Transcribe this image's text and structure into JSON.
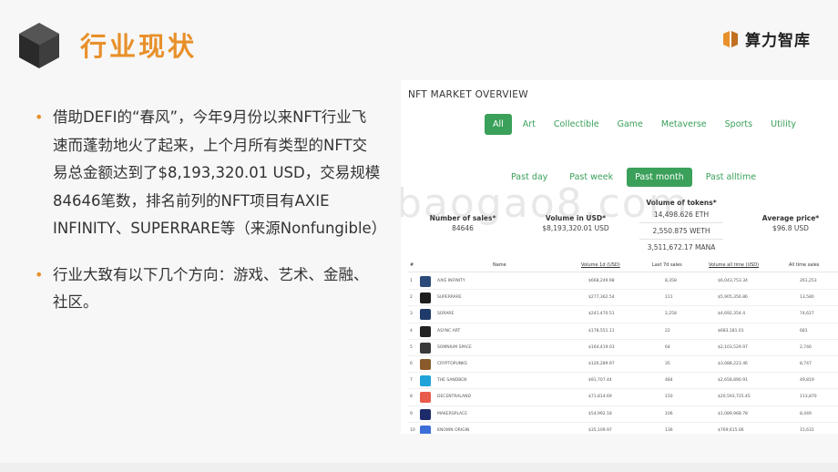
{
  "header": {
    "title": "行业现状",
    "brand": "算力智库"
  },
  "bullets": [
    "借助DEFI的“春风”，今年9月份以来NFT行业飞速而蓬勃地火了起来，上个月所有类型的NFT交易总金额达到了$8,193,320.01 USD，交易规模84646笔数，排名前列的NFT项目有AXIE INFINITY、SUPERRARE等（来源Nonfungible）",
    "行业大致有以下几个方向：游戏、艺术、金融、社区。"
  ],
  "panel": {
    "title": "NFT MARKET OVERVIEW",
    "categories": [
      "All",
      "Art",
      "Collectible",
      "Game",
      "Metaverse",
      "Sports",
      "Utility"
    ],
    "active_category": "All",
    "periods": [
      "Past day",
      "Past week",
      "Past month",
      "Past alltime"
    ],
    "active_period": "Past month",
    "stats": {
      "sales_label": "Number of sales*",
      "sales_value": "84646",
      "usd_label": "Volume in USD*",
      "usd_value": "$8,193,320.01 USD",
      "tokens_label": "Volume of tokens*",
      "tokens_values": [
        "14,498.626 ETH",
        "2,550.875 WETH",
        "3,511,672.17 MANA"
      ],
      "avg_label": "Average price*",
      "avg_value": "$96.8 USD"
    },
    "table": {
      "headers": [
        "#",
        "Name",
        "Volume 1d (USD)",
        "Last 7d sales",
        "Volume all time (USD)",
        "All time sales"
      ],
      "rows": [
        {
          "rank": "1",
          "name": "AXIE INFINITY",
          "vol": "$668,249.98",
          "sales7": "8,358",
          "alltime": "$6,043,753.34",
          "allsales": "261,253",
          "icon_color": "#2b4a7a"
        },
        {
          "rank": "2",
          "name": "SUPERRARE",
          "vol": "$277,362.54",
          "sales7": "111",
          "alltime": "$5,905,356.86",
          "allsales": "13,580",
          "icon_color": "#1d1d1d"
        },
        {
          "rank": "3",
          "name": "SORARE",
          "vol": "$241,470.51",
          "sales7": "2,258",
          "alltime": "$4,692,354.4",
          "allsales": "74,627",
          "icon_color": "#1f3b6b"
        },
        {
          "rank": "4",
          "name": "ASYNC ART",
          "vol": "$178,551.11",
          "sales7": "22",
          "alltime": "$683,181.01",
          "allsales": "681",
          "icon_color": "#222222"
        },
        {
          "rank": "5",
          "name": "SOMNIUM SPACE",
          "vol": "$164,419.03",
          "sales7": "64",
          "alltime": "$2,103,529.97",
          "allsales": "2,746",
          "icon_color": "#3a3a3a"
        },
        {
          "rank": "6",
          "name": "CRYPTOPUNKS",
          "vol": "$126,289.97",
          "sales7": "35",
          "alltime": "$3,088,223.46",
          "allsales": "8,747",
          "icon_color": "#8a5a2b"
        },
        {
          "rank": "7",
          "name": "THE SANDBOX",
          "vol": "$91,707.44",
          "sales7": "484",
          "alltime": "$2,658,890.91",
          "allsales": "49,819",
          "icon_color": "#1fa3d8"
        },
        {
          "rank": "8",
          "name": "DECENTRALAND",
          "vol": "$71,814.69",
          "sales7": "150",
          "alltime": "$20,593,725.45",
          "allsales": "113,870",
          "icon_color": "#e85a4a"
        },
        {
          "rank": "9",
          "name": "MAKERSPLACE",
          "vol": "$54,992.18",
          "sales7": "106",
          "alltime": "$1,089,968.78",
          "allsales": "8,449",
          "icon_color": "#1e2b6b"
        },
        {
          "rank": "10",
          "name": "KNOWN ORIGIN",
          "vol": "$35,109.97",
          "sales7": "136",
          "alltime": "$769,615.06",
          "allsales": "15,631",
          "icon_color": "#3c6ed8"
        }
      ]
    },
    "watermark": "baogao8.com"
  }
}
